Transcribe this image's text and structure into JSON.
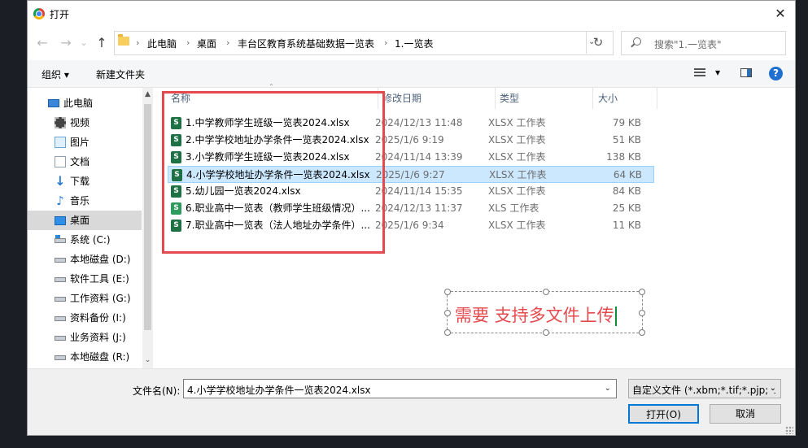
{
  "window": {
    "title": "打开",
    "close": "✕"
  },
  "nav": {
    "back": "←",
    "forward": "→",
    "up": "↑",
    "refresh": "↻",
    "dropdown": "⌄"
  },
  "address": {
    "crumbs": [
      "此电脑",
      "桌面",
      "丰台区教育系统基础数据一览表",
      "1.一览表"
    ],
    "sep": "›"
  },
  "search": {
    "placeholder": "搜索\"1.一览表\""
  },
  "toolbar": {
    "organize": "组织 ▾",
    "new_folder": "新建文件夹",
    "view_dd": "▾",
    "help": "?"
  },
  "sidebar": {
    "items": [
      {
        "label": "此电脑",
        "icon": "computer-icon"
      },
      {
        "label": "视频",
        "icon": "video-folder-icon"
      },
      {
        "label": "图片",
        "icon": "pictures-folder-icon"
      },
      {
        "label": "文档",
        "icon": "documents-folder-icon"
      },
      {
        "label": "下载",
        "icon": "download-icon",
        "glyph": "↓"
      },
      {
        "label": "音乐",
        "icon": "music-icon",
        "glyph": "♪"
      },
      {
        "label": "桌面",
        "icon": "desktop-icon",
        "selected": true
      },
      {
        "label": "系统 (C:)",
        "icon": "system-drive-icon"
      },
      {
        "label": "本地磁盘 (D:)",
        "icon": "drive-icon"
      },
      {
        "label": "软件工具 (E:)",
        "icon": "drive-icon"
      },
      {
        "label": "工作资料 (G:)",
        "icon": "drive-icon"
      },
      {
        "label": "资料备份 (I:)",
        "icon": "drive-icon"
      },
      {
        "label": "业务资料 (J:)",
        "icon": "drive-icon"
      },
      {
        "label": "本地磁盘 (R:)",
        "icon": "drive-icon"
      }
    ],
    "scroll_up": "▲",
    "scroll_down": "⌄"
  },
  "columns": {
    "name": "名称",
    "date": "修改日期",
    "type": "类型",
    "size": "大小",
    "sort_indicator": "⌃"
  },
  "files": [
    {
      "name": "1.中学教师学生班级一览表2024.xlsx",
      "date": "2024/12/13 11:48",
      "type": "XLSX 工作表",
      "size": "79 KB",
      "icon_text": "S"
    },
    {
      "name": "2.中学学校地址办学条件一览表2024.xlsx",
      "date": "2025/1/6 9:19",
      "type": "XLSX 工作表",
      "size": "51 KB",
      "icon_text": "S"
    },
    {
      "name": "3.小学教师学生班级一览表2024.xlsx",
      "date": "2024/11/14 13:39",
      "type": "XLSX 工作表",
      "size": "138 KB",
      "icon_text": "S"
    },
    {
      "name": "4.小学学校地址办学条件一览表2024.xlsx",
      "date": "2025/1/6 9:27",
      "type": "XLSX 工作表",
      "size": "64 KB",
      "icon_text": "S",
      "selected": true
    },
    {
      "name": "5.幼儿园一览表2024.xlsx",
      "date": "2024/11/14 15:35",
      "type": "XLSX 工作表",
      "size": "84 KB",
      "icon_text": "S"
    },
    {
      "name": "6.职业高中一览表（教师学生班级情况）...",
      "date": "2024/12/13 11:37",
      "type": "XLS 工作表",
      "size": "25 KB",
      "icon_text": "S"
    },
    {
      "name": "7.职业高中一览表（法人地址办学条件）...",
      "date": "2025/1/6 9:34",
      "type": "XLSX 工作表",
      "size": "11 KB",
      "icon_text": "S"
    }
  ],
  "annotation": {
    "text": "需要 支持多文件上传",
    "color": "#e5484d"
  },
  "bottom": {
    "filename_label": "文件名(N):",
    "filename_value": "4.小学学校地址办学条件一览表2024.xlsx",
    "filter": "自定义文件 (*.xbm;*.tif;*.pjp;*.",
    "open": "打开(O)",
    "cancel": "取消"
  },
  "colors": {
    "accent": "#0078d7",
    "selection": "#cce8ff",
    "annotation_red": "#e5484d",
    "excel_green": "#1e7145"
  }
}
